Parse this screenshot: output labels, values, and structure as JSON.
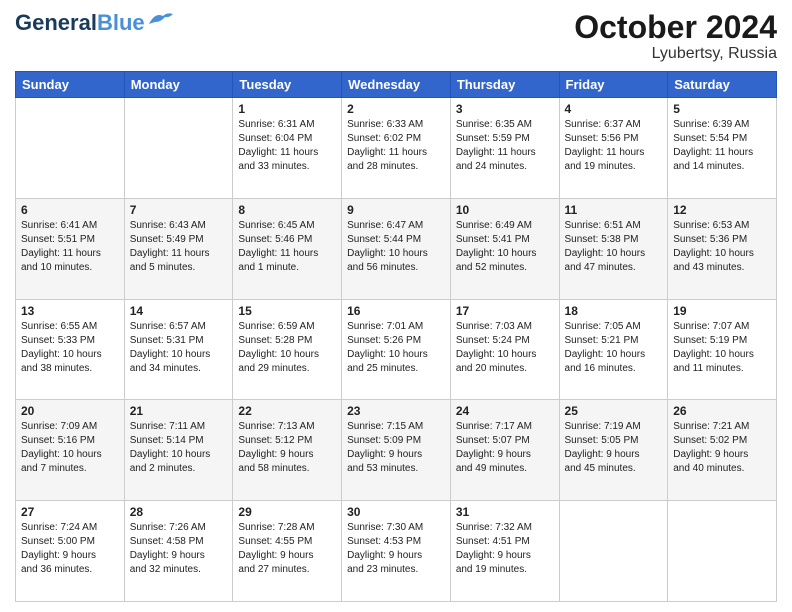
{
  "logo": {
    "line1": "General",
    "line2": "Blue"
  },
  "title": "October 2024",
  "subtitle": "Lyubertsy, Russia",
  "weekdays": [
    "Sunday",
    "Monday",
    "Tuesday",
    "Wednesday",
    "Thursday",
    "Friday",
    "Saturday"
  ],
  "rows": [
    [
      {
        "day": "",
        "info": ""
      },
      {
        "day": "",
        "info": ""
      },
      {
        "day": "1",
        "info": "Sunrise: 6:31 AM\nSunset: 6:04 PM\nDaylight: 11 hours\nand 33 minutes."
      },
      {
        "day": "2",
        "info": "Sunrise: 6:33 AM\nSunset: 6:02 PM\nDaylight: 11 hours\nand 28 minutes."
      },
      {
        "day": "3",
        "info": "Sunrise: 6:35 AM\nSunset: 5:59 PM\nDaylight: 11 hours\nand 24 minutes."
      },
      {
        "day": "4",
        "info": "Sunrise: 6:37 AM\nSunset: 5:56 PM\nDaylight: 11 hours\nand 19 minutes."
      },
      {
        "day": "5",
        "info": "Sunrise: 6:39 AM\nSunset: 5:54 PM\nDaylight: 11 hours\nand 14 minutes."
      }
    ],
    [
      {
        "day": "6",
        "info": "Sunrise: 6:41 AM\nSunset: 5:51 PM\nDaylight: 11 hours\nand 10 minutes."
      },
      {
        "day": "7",
        "info": "Sunrise: 6:43 AM\nSunset: 5:49 PM\nDaylight: 11 hours\nand 5 minutes."
      },
      {
        "day": "8",
        "info": "Sunrise: 6:45 AM\nSunset: 5:46 PM\nDaylight: 11 hours\nand 1 minute."
      },
      {
        "day": "9",
        "info": "Sunrise: 6:47 AM\nSunset: 5:44 PM\nDaylight: 10 hours\nand 56 minutes."
      },
      {
        "day": "10",
        "info": "Sunrise: 6:49 AM\nSunset: 5:41 PM\nDaylight: 10 hours\nand 52 minutes."
      },
      {
        "day": "11",
        "info": "Sunrise: 6:51 AM\nSunset: 5:38 PM\nDaylight: 10 hours\nand 47 minutes."
      },
      {
        "day": "12",
        "info": "Sunrise: 6:53 AM\nSunset: 5:36 PM\nDaylight: 10 hours\nand 43 minutes."
      }
    ],
    [
      {
        "day": "13",
        "info": "Sunrise: 6:55 AM\nSunset: 5:33 PM\nDaylight: 10 hours\nand 38 minutes."
      },
      {
        "day": "14",
        "info": "Sunrise: 6:57 AM\nSunset: 5:31 PM\nDaylight: 10 hours\nand 34 minutes."
      },
      {
        "day": "15",
        "info": "Sunrise: 6:59 AM\nSunset: 5:28 PM\nDaylight: 10 hours\nand 29 minutes."
      },
      {
        "day": "16",
        "info": "Sunrise: 7:01 AM\nSunset: 5:26 PM\nDaylight: 10 hours\nand 25 minutes."
      },
      {
        "day": "17",
        "info": "Sunrise: 7:03 AM\nSunset: 5:24 PM\nDaylight: 10 hours\nand 20 minutes."
      },
      {
        "day": "18",
        "info": "Sunrise: 7:05 AM\nSunset: 5:21 PM\nDaylight: 10 hours\nand 16 minutes."
      },
      {
        "day": "19",
        "info": "Sunrise: 7:07 AM\nSunset: 5:19 PM\nDaylight: 10 hours\nand 11 minutes."
      }
    ],
    [
      {
        "day": "20",
        "info": "Sunrise: 7:09 AM\nSunset: 5:16 PM\nDaylight: 10 hours\nand 7 minutes."
      },
      {
        "day": "21",
        "info": "Sunrise: 7:11 AM\nSunset: 5:14 PM\nDaylight: 10 hours\nand 2 minutes."
      },
      {
        "day": "22",
        "info": "Sunrise: 7:13 AM\nSunset: 5:12 PM\nDaylight: 9 hours\nand 58 minutes."
      },
      {
        "day": "23",
        "info": "Sunrise: 7:15 AM\nSunset: 5:09 PM\nDaylight: 9 hours\nand 53 minutes."
      },
      {
        "day": "24",
        "info": "Sunrise: 7:17 AM\nSunset: 5:07 PM\nDaylight: 9 hours\nand 49 minutes."
      },
      {
        "day": "25",
        "info": "Sunrise: 7:19 AM\nSunset: 5:05 PM\nDaylight: 9 hours\nand 45 minutes."
      },
      {
        "day": "26",
        "info": "Sunrise: 7:21 AM\nSunset: 5:02 PM\nDaylight: 9 hours\nand 40 minutes."
      }
    ],
    [
      {
        "day": "27",
        "info": "Sunrise: 7:24 AM\nSunset: 5:00 PM\nDaylight: 9 hours\nand 36 minutes."
      },
      {
        "day": "28",
        "info": "Sunrise: 7:26 AM\nSunset: 4:58 PM\nDaylight: 9 hours\nand 32 minutes."
      },
      {
        "day": "29",
        "info": "Sunrise: 7:28 AM\nSunset: 4:55 PM\nDaylight: 9 hours\nand 27 minutes."
      },
      {
        "day": "30",
        "info": "Sunrise: 7:30 AM\nSunset: 4:53 PM\nDaylight: 9 hours\nand 23 minutes."
      },
      {
        "day": "31",
        "info": "Sunrise: 7:32 AM\nSunset: 4:51 PM\nDaylight: 9 hours\nand 19 minutes."
      },
      {
        "day": "",
        "info": ""
      },
      {
        "day": "",
        "info": ""
      }
    ]
  ]
}
